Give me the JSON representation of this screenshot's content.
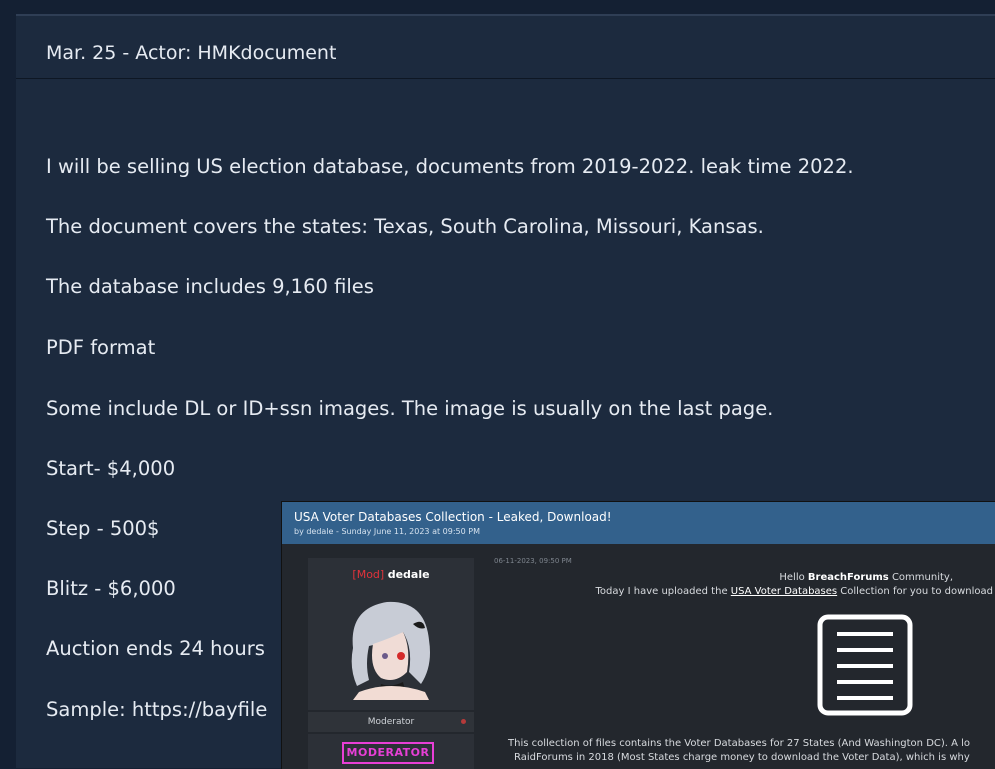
{
  "post": {
    "header": "Mar. 25 - Actor: HMKdocument",
    "lines": [
      "I will be selling US election database, documents from 2019-2022. leak time 2022.",
      "The document covers the states: Texas, South Carolina, Missouri, Kansas.",
      "The database includes 9,160 files",
      "PDF format",
      "Some include DL or ID+ssn images. The image is usually on the last page.",
      "Start- $4,000",
      "Step - 500$",
      "Blitz - $6,000",
      "Auction ends 24 hours",
      "Sample: https://bayfile"
    ]
  },
  "inset": {
    "title": "USA Voter Databases Collection - Leaked, Download!",
    "subtitle": "by dedale - Sunday June 11, 2023 at 09:50 PM",
    "user_role_tag": "[Mod]",
    "username": "dedale",
    "role": "Moderator",
    "badge": "MODERATOR",
    "post_date": "06-11-2023, 09:50 PM",
    "greeting_pre": "Hello ",
    "greeting_bold": "BreachForums",
    "greeting_post": " Community,",
    "upload_pre": "Today I have uploaded the ",
    "upload_link": "USA Voter Databases",
    "upload_post": " Collection for you to download",
    "desc_line1": "This collection of files contains the Voter Databases for 27 States (And Washington DC). A lo",
    "desc_line2": "RaidForums in 2018 (Most States charge money to download the Voter Data), which is why"
  },
  "icons": {
    "document": "document-icon",
    "avatar": "anime-avatar"
  },
  "colors": {
    "page_bg": "#142033",
    "panel_bg": "#1c2a3e",
    "text": "#e6ebf2",
    "inset_bar": "#33618c",
    "mod_red": "#e0333b",
    "badge_magenta": "#e83fd6"
  }
}
